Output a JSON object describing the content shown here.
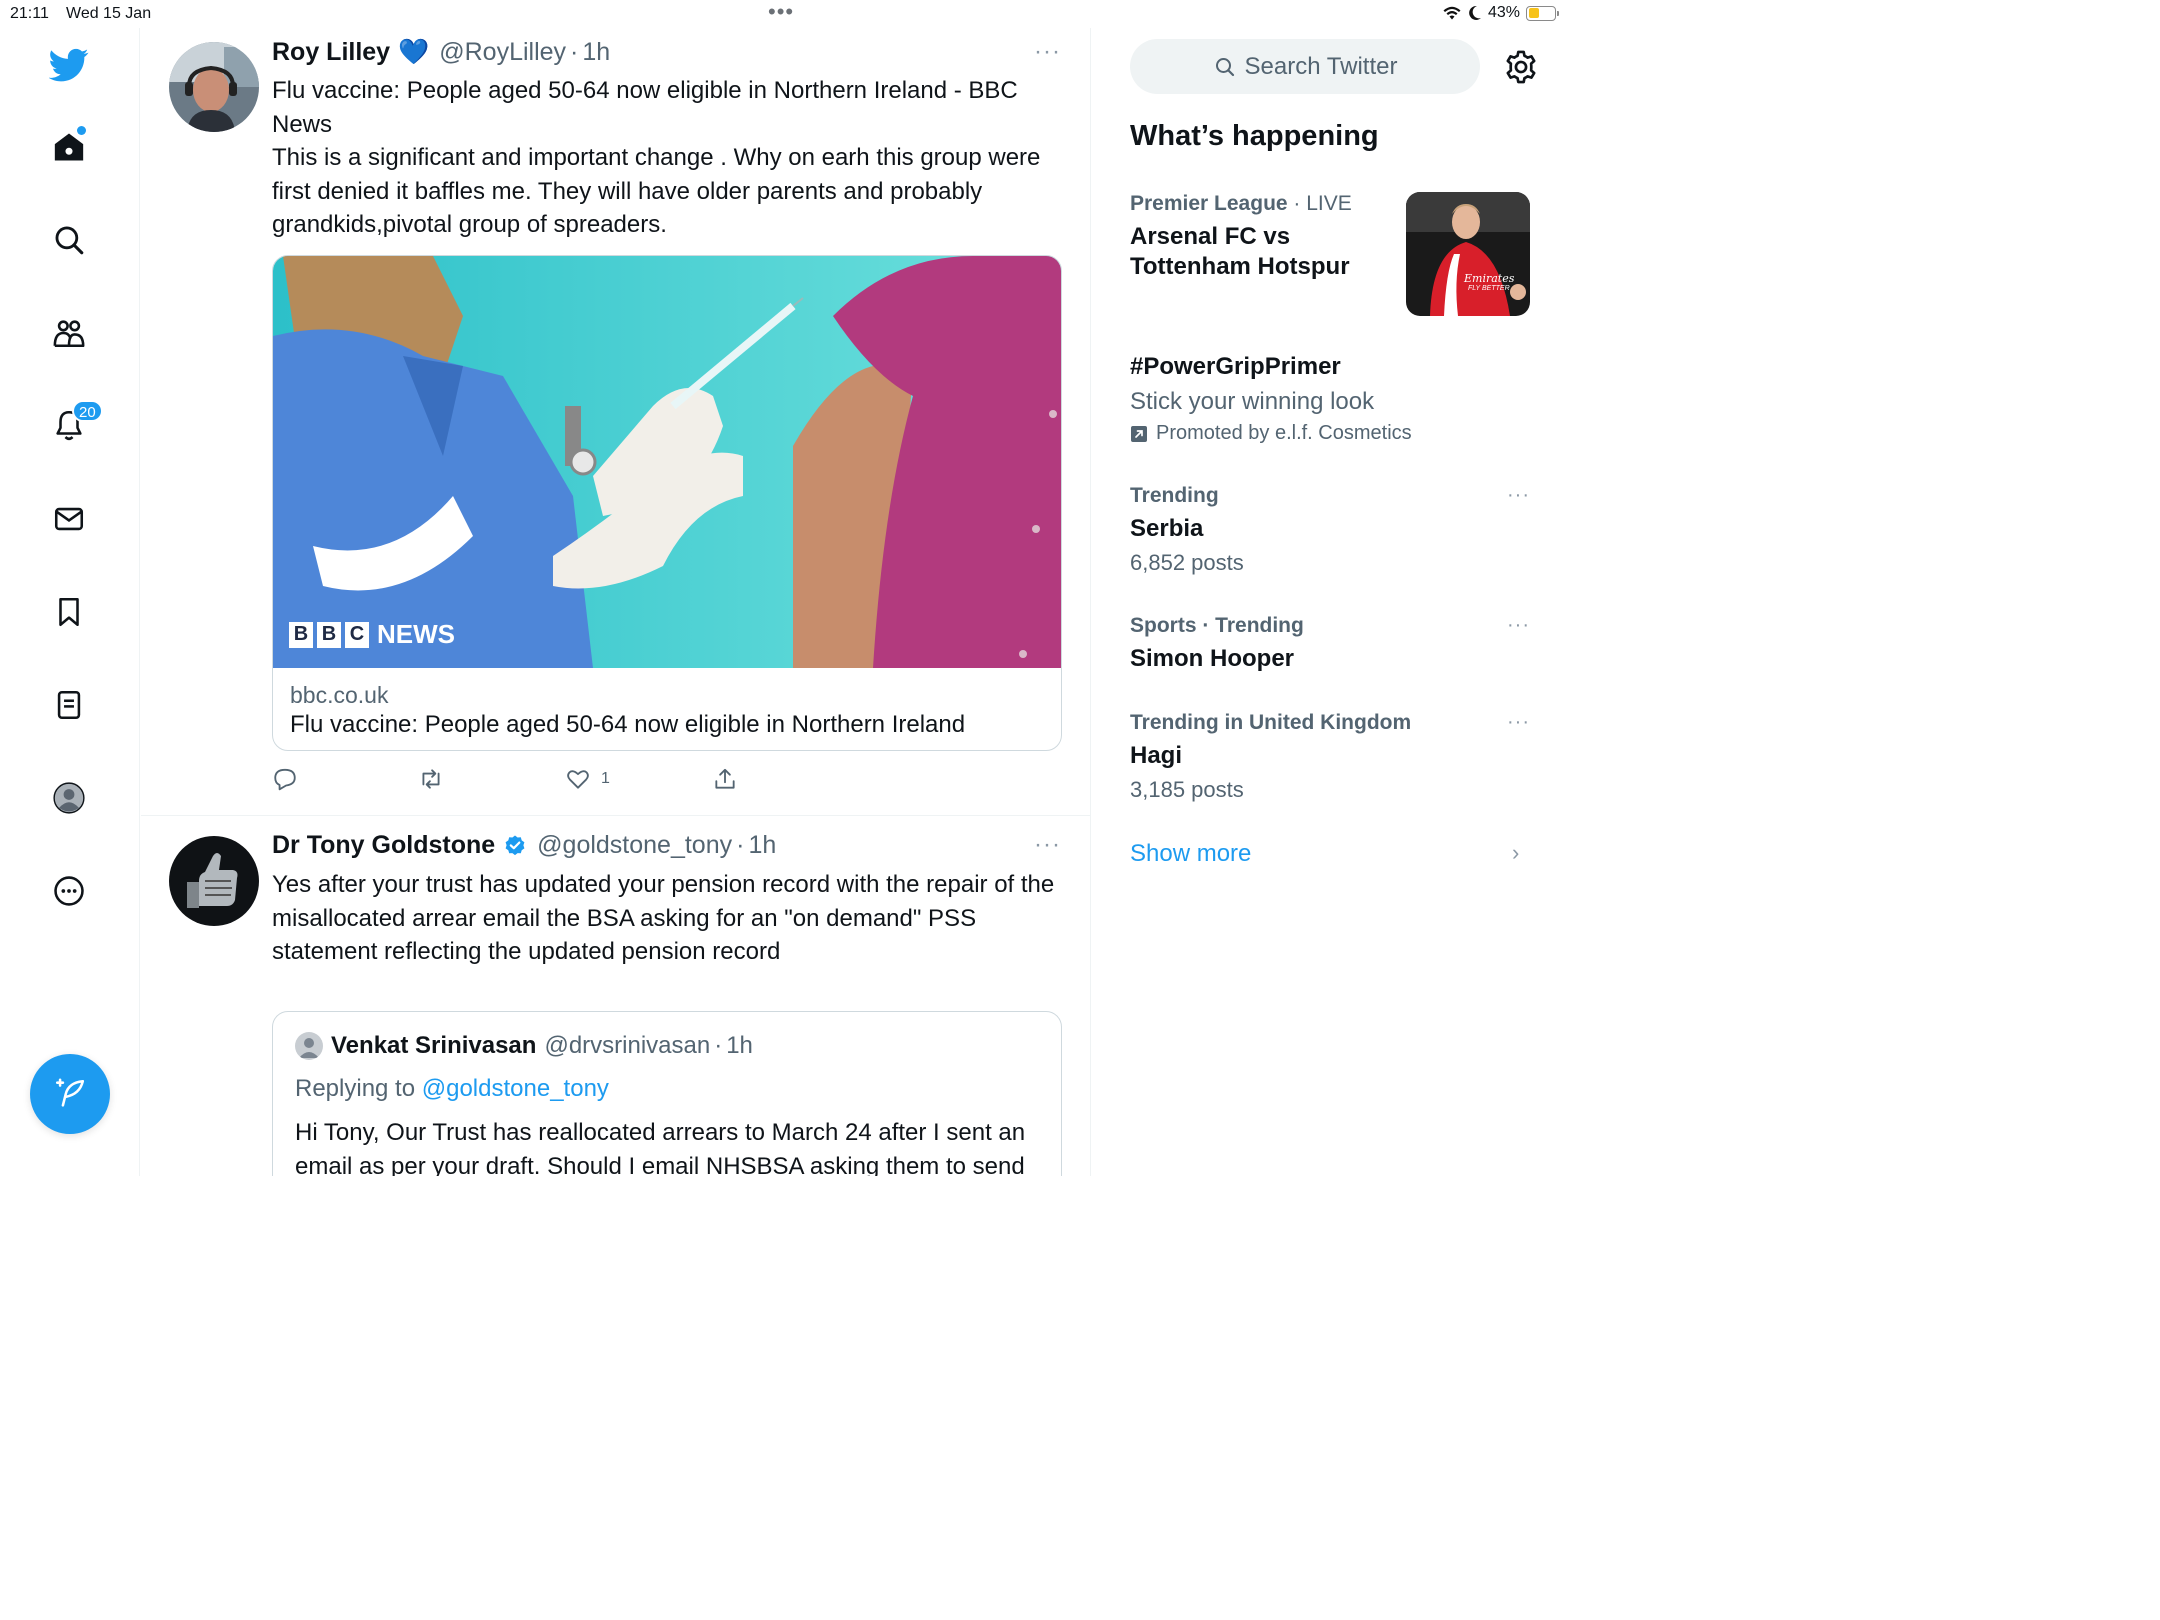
{
  "status_bar": {
    "time": "21:11",
    "date": "Wed 15 Jan",
    "battery": "43%",
    "battery_fraction": 0.43
  },
  "nav": {
    "items": [
      {
        "name": "twitter-logo",
        "icon": "bird-icon"
      },
      {
        "name": "home",
        "icon": "home-icon"
      },
      {
        "name": "explore",
        "icon": "search-icon"
      },
      {
        "name": "communities",
        "icon": "people-icon"
      },
      {
        "name": "notifications",
        "icon": "bell-icon",
        "badge": "20"
      },
      {
        "name": "messages",
        "icon": "mail-icon"
      },
      {
        "name": "bookmarks",
        "icon": "bookmark-icon"
      },
      {
        "name": "lists",
        "icon": "list-icon"
      },
      {
        "name": "profile",
        "icon": "avatar-icon"
      },
      {
        "name": "more",
        "icon": "more-circle-icon"
      }
    ],
    "compose_icon": "compose-feather-icon"
  },
  "feed": {
    "tweets": [
      {
        "name": "Roy Lilley",
        "heart": "💙",
        "handle": "@RoyLilley",
        "dot": "·",
        "time": "1h",
        "more": "···",
        "text_line1": "Flu vaccine: People aged 50-64 now eligible in Northern Ireland - BBC News",
        "text_line2": "This is a significant and important change . Why on earh this group were first denied it baffles me.  They will have older parents and probably grandkids,pivotal group of spreaders.",
        "card": {
          "image_logo": [
            "B",
            "B",
            "C"
          ],
          "image_logo_word": "NEWS",
          "domain": "bbc.co.uk",
          "title": "Flu vaccine: People aged 50-64 now eligible in Northern Ireland"
        },
        "actions": {
          "reply_count": "",
          "retweet_count": "",
          "like_count": "1",
          "share_count": ""
        }
      },
      {
        "name": "Dr Tony Goldstone",
        "verified": true,
        "handle": "@goldstone_tony",
        "dot": "·",
        "time": "1h",
        "more": "···",
        "text": "Yes after your trust has updated your pension record with the repair of the misallocated arrear email the BSA asking for an \"on demand\" PSS statement reflecting the updated pension record",
        "quote": {
          "name": "Venkat Srinivasan",
          "handle": "@drvsrinivasan",
          "dot": "·",
          "time": "1h",
          "replying_prefix": "Replying to ",
          "replying_to": "@goldstone_tony",
          "text": "Hi Tony, Our Trust has reallocated arrears to March 24 after I sent an email as per your draft. Should I email  NHSBSA asking them to send a revised statement based on the new figures"
        }
      }
    ]
  },
  "right": {
    "search_placeholder": "Search Twitter",
    "section_title": "What’s happening",
    "trends": [
      {
        "meta_strong": "Premier League",
        "meta_rest": " · LIVE",
        "name": "Arsenal FC vs Tottenham Hotspur",
        "sub": ""
      },
      {
        "meta_strong": "",
        "meta_rest": "",
        "name": "#PowerGripPrimer",
        "sub": "Stick your winning look",
        "promoted": "Promoted by e.l.f. Cosmetics"
      },
      {
        "meta_strong": "Trending",
        "meta_rest": "",
        "name": "Serbia",
        "sub": "6,852 posts"
      },
      {
        "meta_strong": "Sports · Trending",
        "meta_rest": "",
        "name": "Simon Hooper",
        "sub": ""
      },
      {
        "meta_strong": "Trending in United Kingdom",
        "meta_rest": "",
        "name": "Hagi",
        "sub": "3,185 posts"
      }
    ],
    "trend_more": "···",
    "thumb_sponsor": "Emirates",
    "thumb_sponsor_sub": "FLY BETTER",
    "show_more": "Show more",
    "show_more_chevron": "›"
  },
  "colors": {
    "accent": "#1d9bf0",
    "text": "#0f1419",
    "secondary": "#536471",
    "border": "#cfd9de"
  }
}
